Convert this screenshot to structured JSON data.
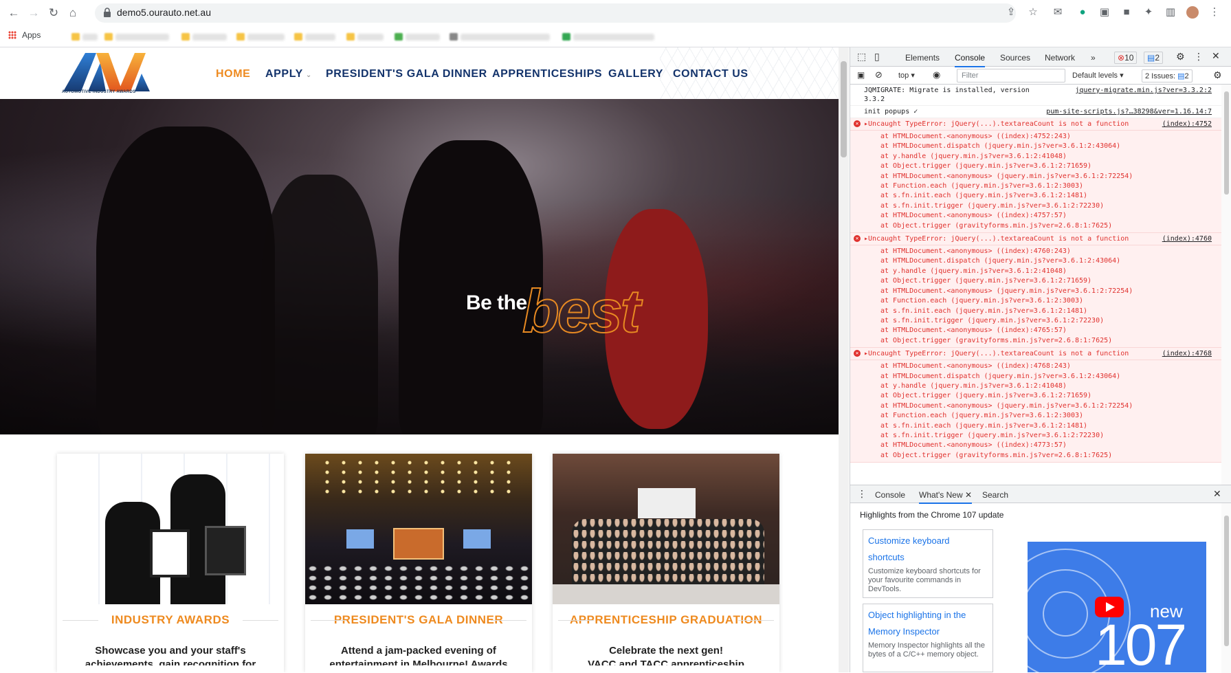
{
  "browser": {
    "url": "demo5.ourauto.net.au",
    "bookmarks_label": "Apps"
  },
  "site": {
    "logo_caption": "AUTOMOTIVE INDUSTRY AWARDS",
    "nav": [
      {
        "label": "HOME",
        "active": true
      },
      {
        "label": "APPLY",
        "active": false,
        "has_dropdown": true
      },
      {
        "label": "PRESIDENT'S GALA DINNER",
        "active": false
      },
      {
        "label": "APPRENTICESHIPS",
        "active": false
      },
      {
        "label": "GALLERY",
        "active": false
      },
      {
        "label": "CONTACT US",
        "active": false
      }
    ],
    "hero": {
      "tagline_prefix": "Be the",
      "tagline_emphasis": "best"
    },
    "cards": [
      {
        "title": "INDUSTRY AWARDS",
        "description": "Showcase you and your staff's",
        "description_cont": "achievements, gain recognition for"
      },
      {
        "title": "PRESIDENT'S GALA DINNER",
        "description": "Attend a jam-packed evening of",
        "description_cont": "entertainment in Melbourne! Awards"
      },
      {
        "title": "APPRENTICESHIP GRADUATION",
        "description": "Celebrate the next gen!",
        "description_cont": "VACC and TACC apprenticeship graduates"
      }
    ],
    "accent_color": "#ee8a1f",
    "nav_color": "#13336b"
  },
  "devtools": {
    "tabs": [
      "Elements",
      "Console",
      "Sources",
      "Network"
    ],
    "active_tab": "Console",
    "more_tabs": "»",
    "error_count": "10",
    "info_count": "2",
    "context": "top",
    "filter_placeholder": "Filter",
    "levels": "Default levels",
    "issues_label": "2 Issues:",
    "issues_count": "2",
    "messages": [
      {
        "type": "log",
        "text": "JQMIGRATE: Migrate is installed, version 3.3.2",
        "source": "jquery-migrate.min.js?ver=3.3.2:2"
      },
      {
        "type": "log",
        "text": "init popups ✓",
        "source": "pum-site-scripts.js?…38298&ver=1.16.14:7"
      },
      {
        "type": "error",
        "text": "▸Uncaught TypeError: jQuery(...).textareaCount is not a function",
        "source": "(index):4752",
        "stack": [
          "at HTMLDocument.<anonymous> ((index):4752:243)",
          "at HTMLDocument.dispatch (jquery.min.js?ver=3.6.1:2:43064)",
          "at y.handle (jquery.min.js?ver=3.6.1:2:41048)",
          "at Object.trigger (jquery.min.js?ver=3.6.1:2:71659)",
          "at HTMLDocument.<anonymous> (jquery.min.js?ver=3.6.1:2:72254)",
          "at Function.each (jquery.min.js?ver=3.6.1:2:3003)",
          "at s.fn.init.each (jquery.min.js?ver=3.6.1:2:1481)",
          "at s.fn.init.trigger (jquery.min.js?ver=3.6.1:2:72230)",
          "at HTMLDocument.<anonymous> ((index):4757:57)",
          "at Object.trigger (gravityforms.min.js?ver=2.6.8:1:7625)"
        ]
      },
      {
        "type": "error",
        "text": "▸Uncaught TypeError: jQuery(...).textareaCount is not a function",
        "source": "(index):4760",
        "stack": [
          "at HTMLDocument.<anonymous> ((index):4760:243)",
          "at HTMLDocument.dispatch (jquery.min.js?ver=3.6.1:2:43064)",
          "at y.handle (jquery.min.js?ver=3.6.1:2:41048)",
          "at Object.trigger (jquery.min.js?ver=3.6.1:2:71659)",
          "at HTMLDocument.<anonymous> (jquery.min.js?ver=3.6.1:2:72254)",
          "at Function.each (jquery.min.js?ver=3.6.1:2:3003)",
          "at s.fn.init.each (jquery.min.js?ver=3.6.1:2:1481)",
          "at s.fn.init.trigger (jquery.min.js?ver=3.6.1:2:72230)",
          "at HTMLDocument.<anonymous> ((index):4765:57)",
          "at Object.trigger (gravityforms.min.js?ver=2.6.8:1:7625)"
        ]
      },
      {
        "type": "error",
        "text": "▸Uncaught TypeError: jQuery(...).textareaCount is not a function",
        "source": "(index):4768",
        "stack": [
          "at HTMLDocument.<anonymous> ((index):4768:243)",
          "at HTMLDocument.dispatch (jquery.min.js?ver=3.6.1:2:43064)",
          "at y.handle (jquery.min.js?ver=3.6.1:2:41048)",
          "at Object.trigger (jquery.min.js?ver=3.6.1:2:71659)",
          "at HTMLDocument.<anonymous> (jquery.min.js?ver=3.6.1:2:72254)",
          "at Function.each (jquery.min.js?ver=3.6.1:2:3003)",
          "at s.fn.init.each (jquery.min.js?ver=3.6.1:2:1481)",
          "at s.fn.init.trigger (jquery.min.js?ver=3.6.1:2:72230)",
          "at HTMLDocument.<anonymous> ((index):4773:57)",
          "at Object.trigger (gravityforms.min.js?ver=2.6.8:1:7625)"
        ]
      }
    ],
    "drawer": {
      "tabs": [
        "Console",
        "What's New",
        "Search"
      ],
      "active_tab": "What's New",
      "headline": "Highlights from the Chrome 107 update",
      "features": [
        {
          "title": "Customize keyboard shortcuts",
          "desc": "Customize keyboard shortcuts for your favourite commands in DevTools."
        },
        {
          "title": "Object highlighting in the Memory Inspector",
          "desc": "Memory Inspector highlights all the bytes of a C/C++ memory object."
        }
      ],
      "banner_new": "new",
      "banner_version": "107"
    }
  }
}
